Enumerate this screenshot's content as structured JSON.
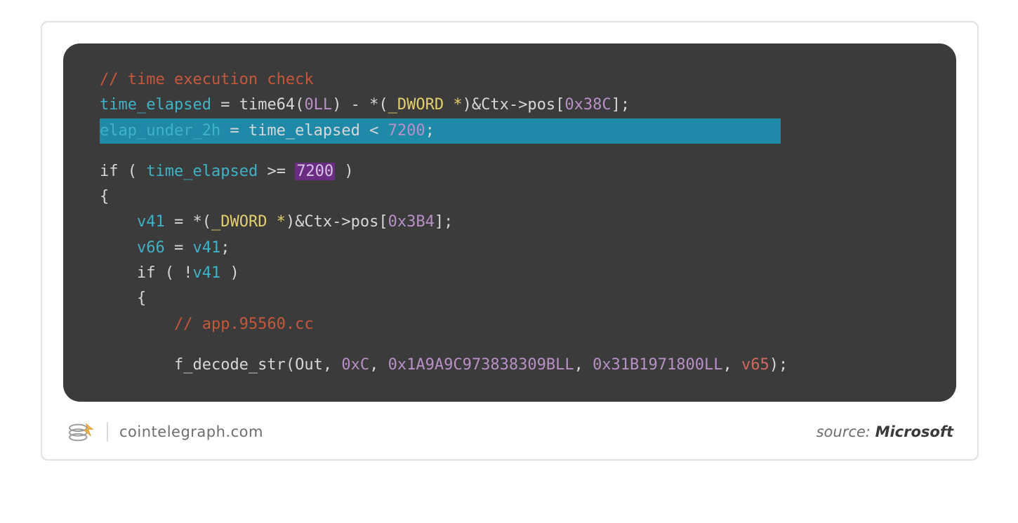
{
  "code": {
    "comment1": "// time execution check",
    "l2": {
      "ident": "time_elapsed",
      "eq": " = ",
      "func": "time64",
      "args_open": "(",
      "arg0": "0LL",
      "args_mid": ") - *(",
      "type": "_DWORD *",
      "after_type": ")&Ctx->pos[",
      "idx": "0x38C",
      "close": "];"
    },
    "l3": {
      "ident": "elap_under_2h",
      "mid": " = time_elapsed < ",
      "num": "7200",
      "end": ";"
    },
    "l4": {
      "kw": "if",
      "open": " ( ",
      "ident": "time_elapsed",
      "op": " >= ",
      "num": "7200",
      "close": " )"
    },
    "brace_open": "{",
    "l6": {
      "indent": "    ",
      "ident": "v41",
      "mid": " = *(",
      "type": "_DWORD *",
      "after": ")&Ctx->pos[",
      "idx": "0x3B4",
      "close": "];"
    },
    "l7": {
      "indent": "    ",
      "ident": "v66",
      "mid": " = ",
      "rhs": "v41",
      "end": ";"
    },
    "l8": {
      "indent": "    ",
      "kw": "if",
      "open": " ( !",
      "ident": "v41",
      "close": " )"
    },
    "l9": {
      "indent": "    ",
      "brace": "{"
    },
    "comment2": {
      "indent": "        ",
      "text": "// app.95560.cc"
    },
    "l11": {
      "indent": "        ",
      "func": "f_decode_str",
      "open": "(Out, ",
      "a1": "0xC",
      "c1": ", ",
      "a2": "0x1A9A9C973838309BLL",
      "c2": ", ",
      "a3": "0x31B1971800LL",
      "c3": ", ",
      "a4": "v65",
      "close": ");"
    }
  },
  "footer": {
    "domain": "cointelegraph.com",
    "source_label": "source: ",
    "source_name": "Microsoft"
  }
}
